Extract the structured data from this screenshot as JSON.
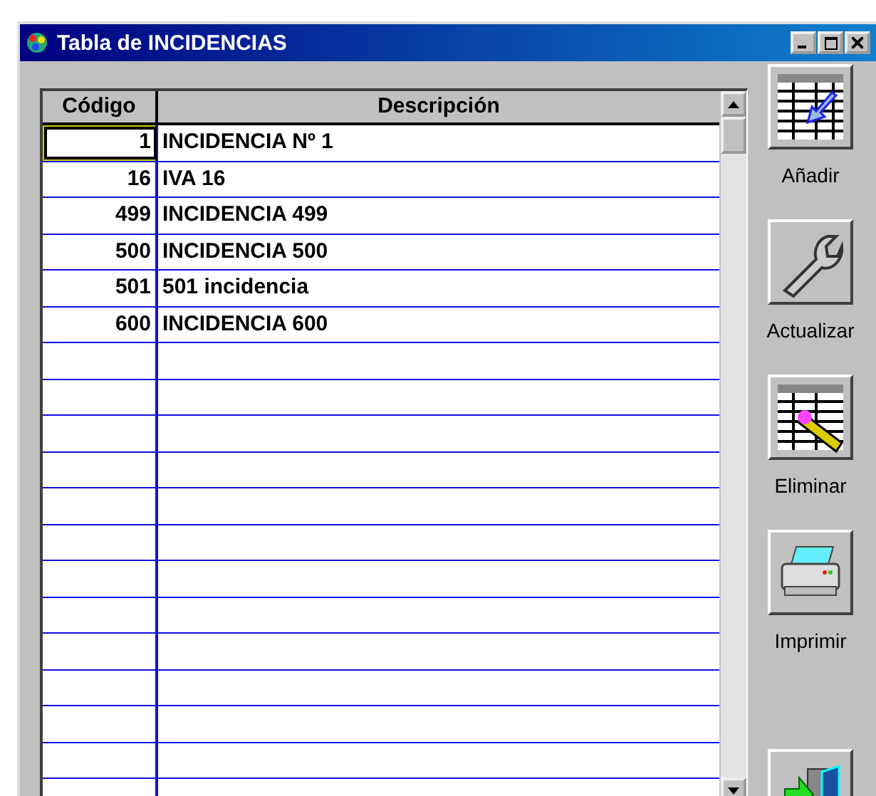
{
  "window": {
    "title": "Tabla de INCIDENCIAS"
  },
  "table": {
    "columns": [
      "Código",
      "Descripción"
    ],
    "rows": [
      {
        "code": "1",
        "description": "INCIDENCIA Nº 1",
        "selected": true
      },
      {
        "code": "16",
        "description": "IVA 16",
        "selected": false
      },
      {
        "code": "499",
        "description": "INCIDENCIA 499",
        "selected": false
      },
      {
        "code": "500",
        "description": "INCIDENCIA 500",
        "selected": false
      },
      {
        "code": "501",
        "description": "501 incidencia",
        "selected": false
      },
      {
        "code": "600",
        "description": "INCIDENCIA 600",
        "selected": false
      }
    ]
  },
  "toolbar": [
    {
      "kind": "add",
      "label": "Añadir"
    },
    {
      "kind": "update",
      "label": "Actualizar"
    },
    {
      "kind": "delete",
      "label": "Eliminar"
    },
    {
      "kind": "print",
      "label": "Imprimir"
    },
    {
      "kind": "exit"
    }
  ]
}
